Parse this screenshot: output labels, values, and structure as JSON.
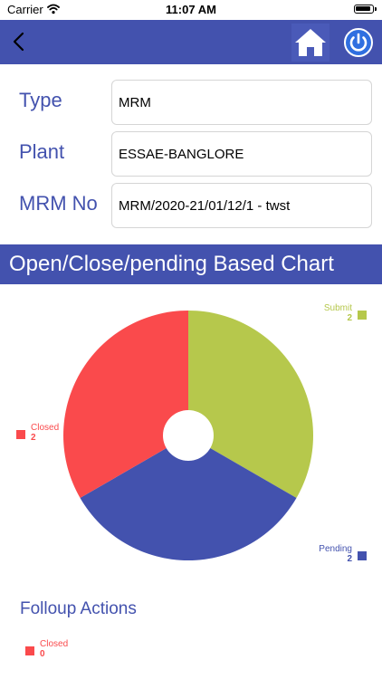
{
  "status_bar": {
    "carrier": "Carrier",
    "time": "11:07 AM"
  },
  "nav": {
    "back_icon": "chevron-left-icon",
    "home_icon": "home-icon",
    "power_icon": "power-icon",
    "color": "#4352ae"
  },
  "form": {
    "type": {
      "label": "Type",
      "value": "MRM"
    },
    "plant": {
      "label": "Plant",
      "value": "ESSAE-BANGLORE"
    },
    "mrm_no": {
      "label": "MRM No",
      "value": "MRM/2020-21/01/12/1 - twst"
    }
  },
  "chart_section": {
    "title": "Open/Close/pending Based Chart"
  },
  "chart_data": {
    "type": "pie",
    "hole": true,
    "slices": [
      {
        "name": "Submit",
        "value": 2,
        "color": "#b6c84c"
      },
      {
        "name": "Pending",
        "value": 2,
        "color": "#4352ae"
      },
      {
        "name": "Closed",
        "value": 2,
        "color": "#fa4a4c"
      }
    ]
  },
  "followup": {
    "title": "Folloup Actions",
    "chart_data": {
      "type": "pie",
      "slices": [
        {
          "name": "Closed",
          "value": 0,
          "color": "#fa4a4c"
        }
      ]
    }
  }
}
